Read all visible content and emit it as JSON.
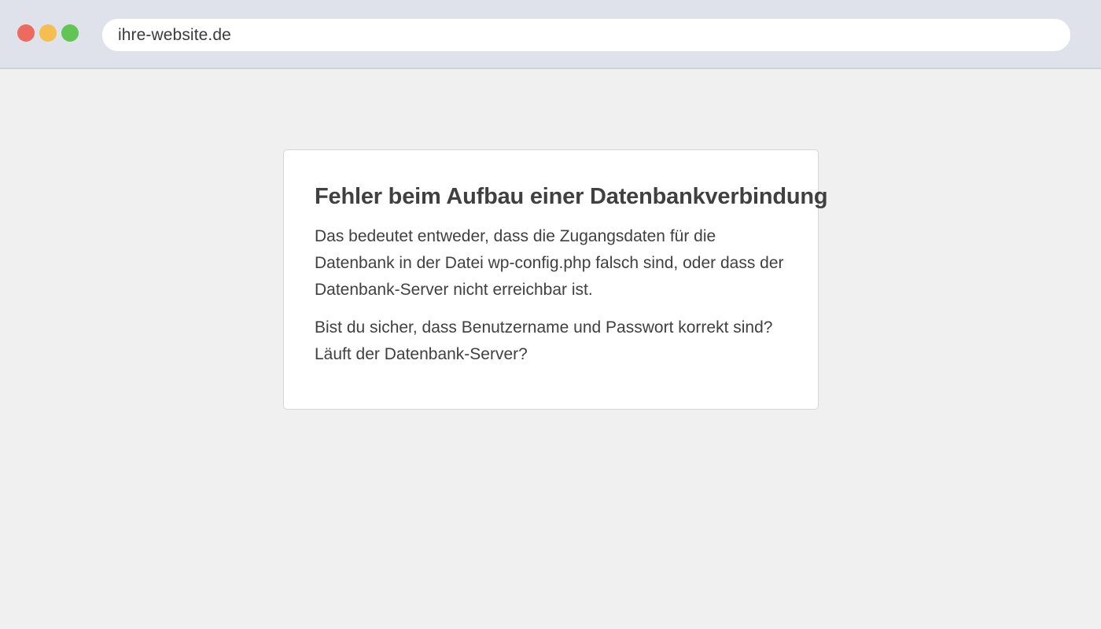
{
  "browser": {
    "url": "ihre-website.de",
    "window_controls": [
      {
        "name": "close",
        "color": "#ec6a5e"
      },
      {
        "name": "minimize",
        "color": "#f5bf4f"
      },
      {
        "name": "maximize",
        "color": "#61c554"
      }
    ]
  },
  "error": {
    "title": "Fehler beim Aufbau einer Datenbankverbindung",
    "paragraph_1": "Das bedeutet entweder, dass die Zugangsdaten für die Datenbank in der Datei wp-config.php falsch sind, oder dass der Datenbank-Server nicht erreichbar ist.",
    "paragraph_2": "Bist du sicher, dass Benutzername und Passwort korrekt sind? Läuft der Datenbank-Server?"
  }
}
